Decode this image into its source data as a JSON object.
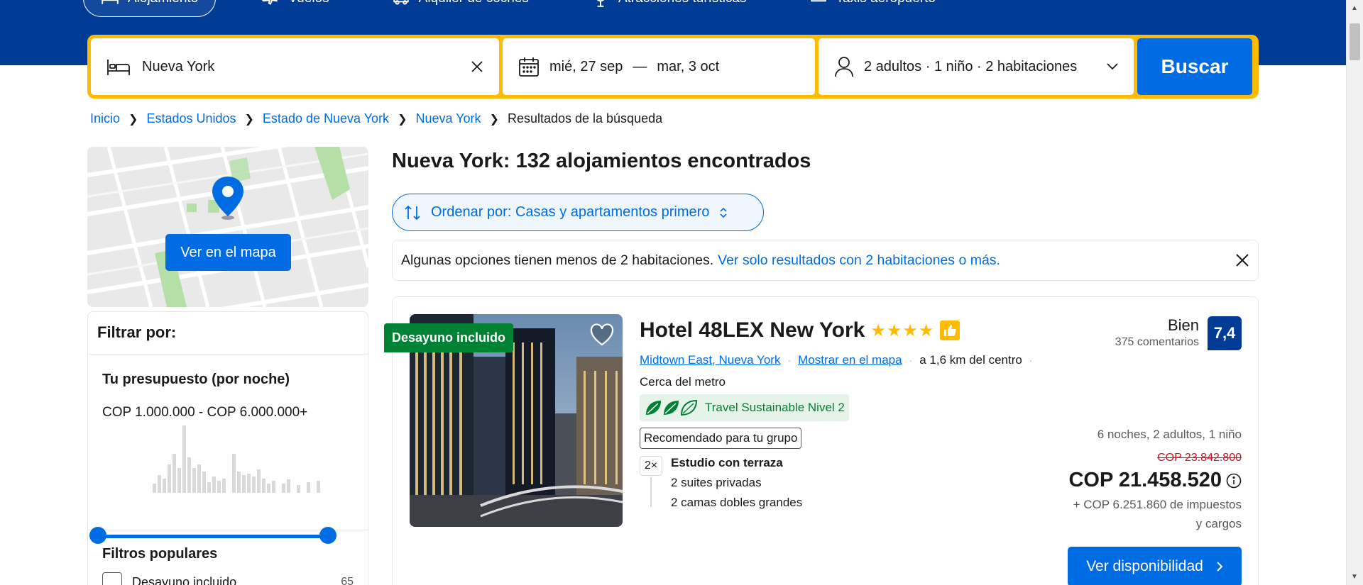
{
  "nav": {
    "items": [
      {
        "label": "Alojamiento",
        "icon": "bed-icon"
      },
      {
        "label": "Vuelos",
        "icon": "plane-icon"
      },
      {
        "label": "Alquiler de coches",
        "icon": "car-icon"
      },
      {
        "label": "Atracciones turísticas",
        "icon": "attraction-icon"
      },
      {
        "label": "Taxis aeropuerto",
        "icon": "taxi-icon"
      }
    ]
  },
  "search": {
    "destination": "Nueva York",
    "checkin": "mié, 27 sep",
    "dash": "—",
    "checkout": "mar, 3 oct",
    "guests": "2 adultos · 1 niño · 2 habitaciones",
    "button": "Buscar"
  },
  "breadcrumb": {
    "items": [
      "Inicio",
      "Estados Unidos",
      "Estado de Nueva York",
      "Nueva York"
    ],
    "current": "Resultados de la búsqueda"
  },
  "map": {
    "button": "Ver en el mapa"
  },
  "filters": {
    "title": "Filtrar por:",
    "budget_title": "Tu presupuesto (por noche)",
    "budget_range": "COP 1.000.000 - COP 6.000.000+",
    "popular_title": "Filtros populares",
    "popular": [
      {
        "label": "Desayuno incluido",
        "count": "65"
      }
    ]
  },
  "results": {
    "title": "Nueva York: 132 alojamientos encontrados",
    "sort_label": "Ordenar por: Casas y apartamentos primero",
    "notice_text": "Algunas opciones tienen menos de 2 habitaciones.",
    "notice_link": "Ver solo resultados con 2 habitaciones o más."
  },
  "hotel": {
    "badge": "Desayuno incluido",
    "name": "Hotel 48LEX New York",
    "stars": "★★★★",
    "area": "Midtown East, Nueva York",
    "map_link": "Mostrar en el mapa",
    "distance": "a 1,6 km del centro",
    "metro": "Cerca del metro",
    "sustainable": "Travel Sustainable Nivel 2",
    "recommended": "Recomendado para tu grupo",
    "room_qty": "2×",
    "room_name": "Estudio con terraza",
    "room_line1": "2 suites privadas",
    "room_line2": "2 camas dobles grandes",
    "rating_word": "Bien",
    "reviews": "375 comentarios",
    "score": "7,4",
    "stay": "6 noches, 2 adultos, 1 niño",
    "old_price": "COP 23.842.800",
    "price": "COP 21.458.520",
    "taxes": "+ COP 6.251.860 de impuestos",
    "taxes2": "y cargos",
    "cta": "Ver disponibilidad"
  },
  "colors": {
    "brand": "#003b95",
    "accent": "#006ce4",
    "yellow": "#febb02",
    "green": "#008234"
  }
}
